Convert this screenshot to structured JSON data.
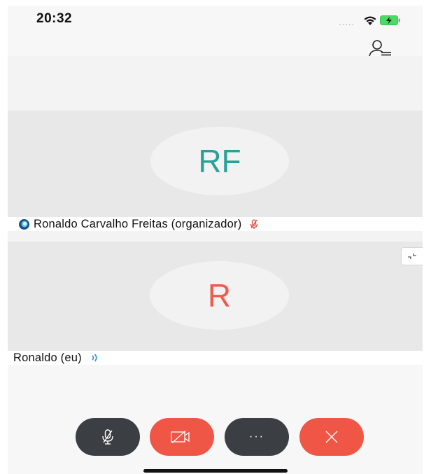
{
  "status_bar": {
    "time": "20:32",
    "signal_dots": ".....",
    "icons": [
      "wifi-icon",
      "battery-charging-icon"
    ]
  },
  "header": {
    "participants_icon": "participants-list-icon"
  },
  "participants": [
    {
      "initials": "RF",
      "initials_color": "#2aa198",
      "name": "Ronaldo Carvalho Freitas (organizador)",
      "status_icon": "presence-icon",
      "mic_icon": "mic-muted-icon",
      "mic_color": "#e8473a"
    },
    {
      "initials": "R",
      "initials_color": "#ef5b4f",
      "name": "Ronaldo (eu)",
      "audio_icon": "audio-active-icon",
      "audio_color": "#1f9ad6"
    }
  ],
  "controls": [
    {
      "icon": "mic-muted-icon",
      "color": "#3b3e43"
    },
    {
      "icon": "video-off-icon",
      "color": "#ef5646"
    },
    {
      "icon": "more-icon",
      "label": "···",
      "color": "#3b3e43"
    },
    {
      "icon": "hang-up-icon",
      "color": "#ef5646"
    }
  ]
}
